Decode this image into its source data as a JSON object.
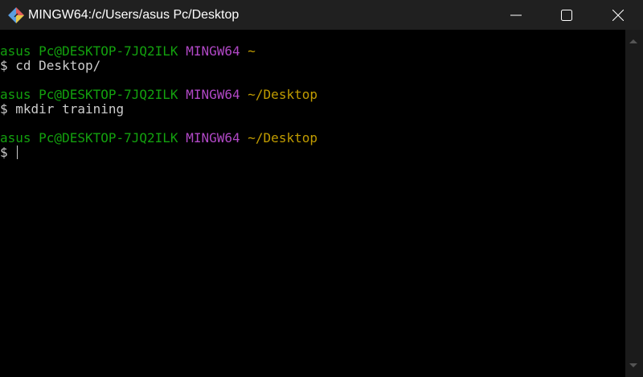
{
  "window": {
    "title": "MINGW64:/c/Users/asus Pc/Desktop"
  },
  "colors": {
    "user_host": "#13a10e",
    "system": "#b148c6",
    "path": "#c19c00",
    "text": "#cccccc"
  },
  "terminal": {
    "blocks": [
      {
        "user_host": "asus Pc@DESKTOP-7JQ2ILK",
        "system": "MINGW64",
        "path": "~",
        "command": "$ cd Desktop/"
      },
      {
        "user_host": "asus Pc@DESKTOP-7JQ2ILK",
        "system": "MINGW64",
        "path": "~/Desktop",
        "command": "$ mkdir training"
      },
      {
        "user_host": "asus Pc@DESKTOP-7JQ2ILK",
        "system": "MINGW64",
        "path": "~/Desktop",
        "command": "$ "
      }
    ]
  }
}
